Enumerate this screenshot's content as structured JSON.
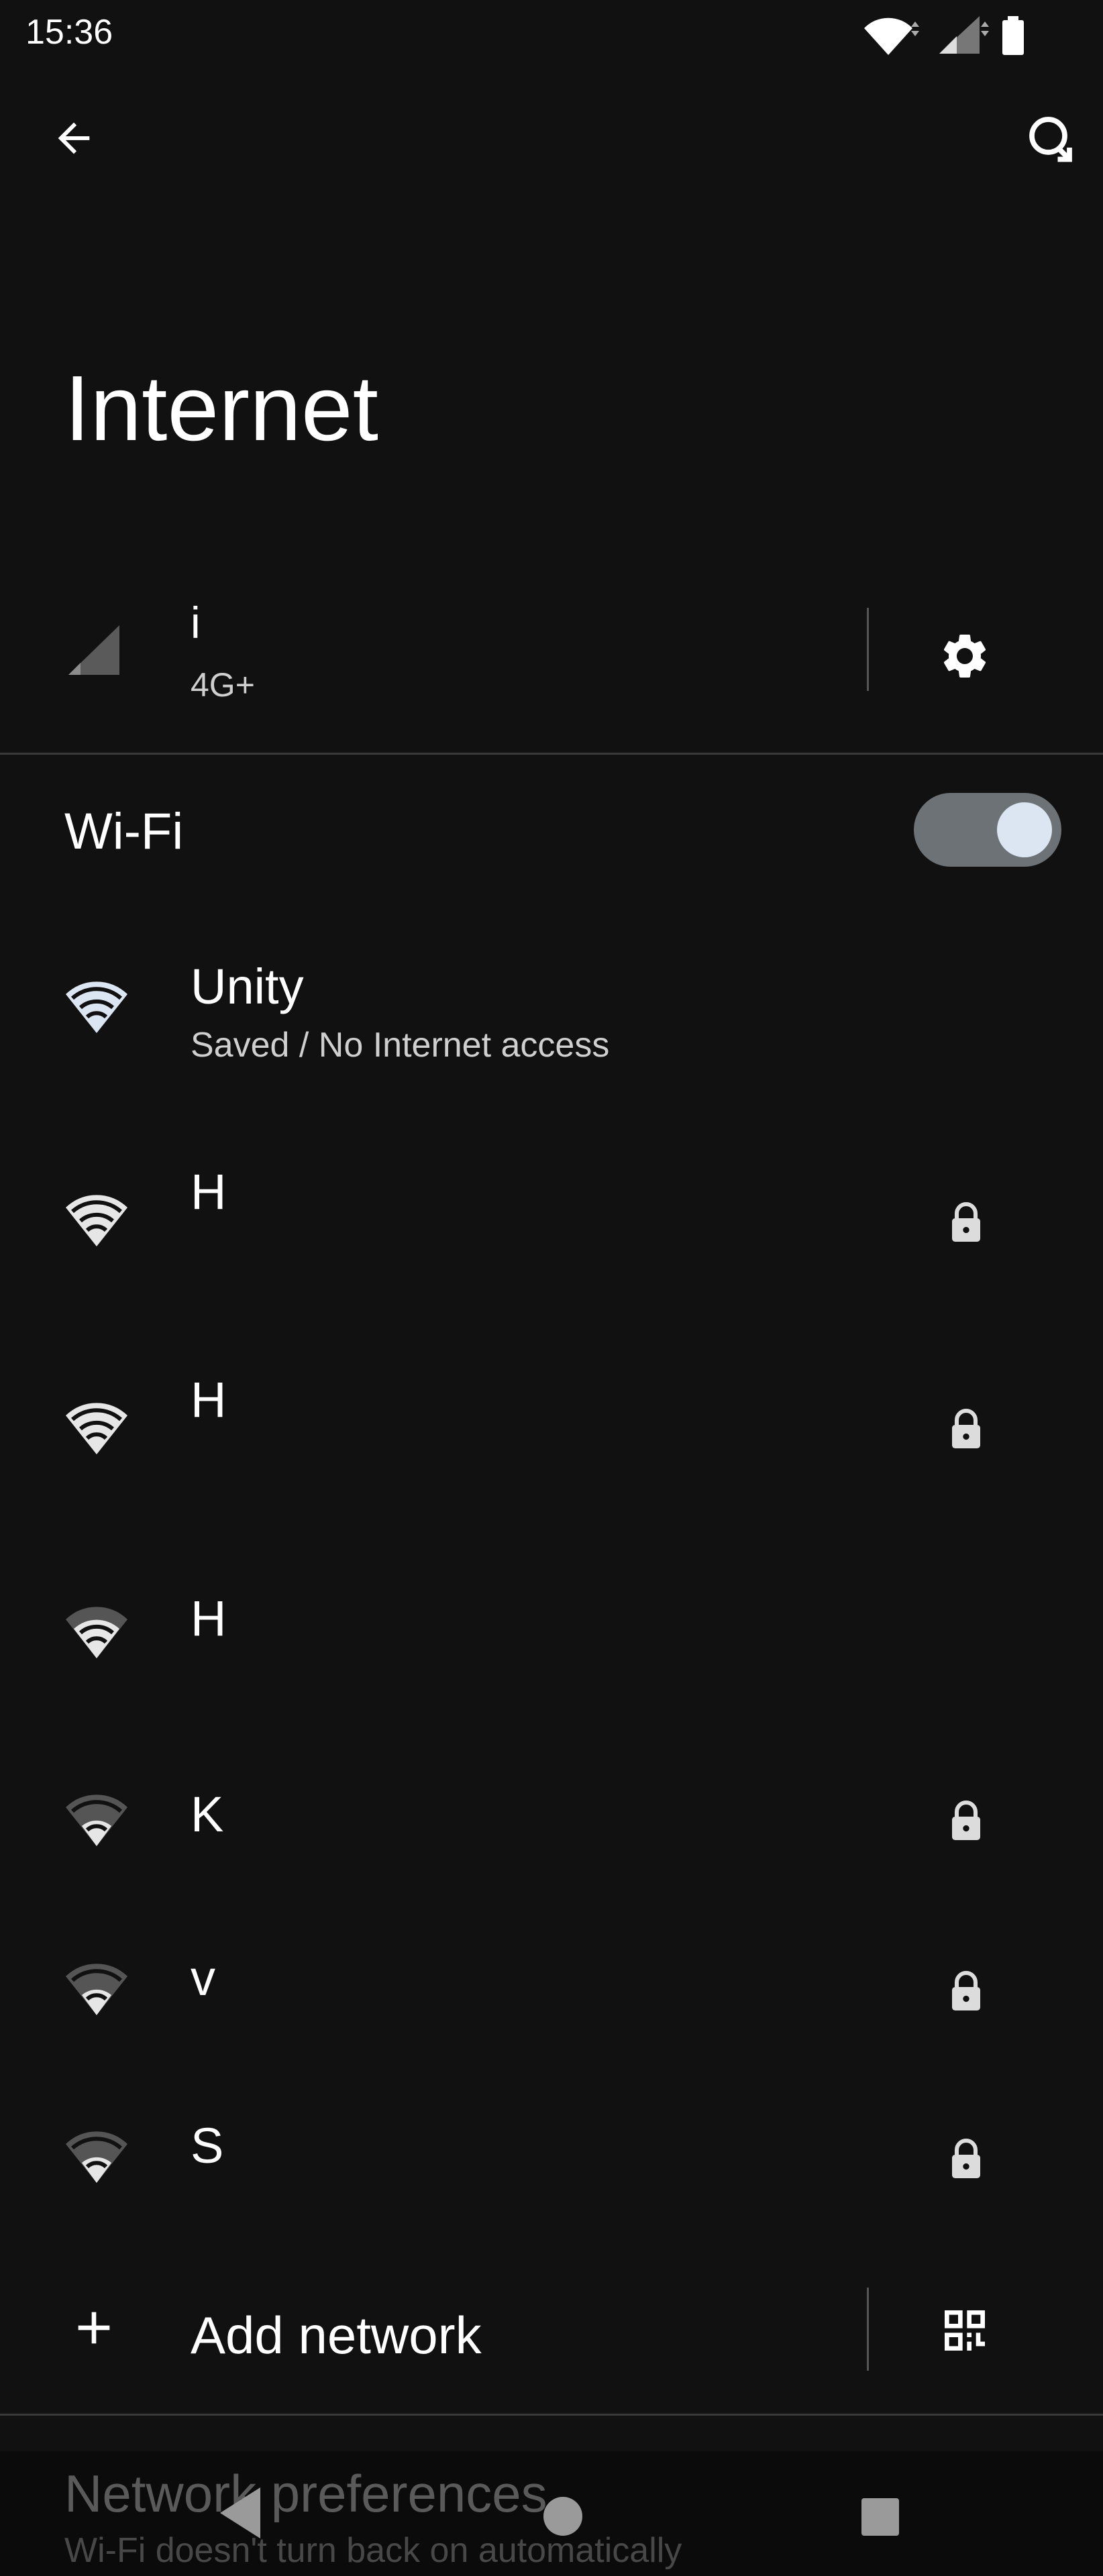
{
  "status_bar": {
    "time": "15:36",
    "icons": [
      "wifi-icon",
      "cell-signal-icon",
      "battery-icon"
    ]
  },
  "app_bar": {
    "back_icon": "arrow-back-icon",
    "refresh_icon": "refresh-icon"
  },
  "title": "Internet",
  "mobile": {
    "name": "i",
    "network_type": "4G+",
    "settings_icon": "gear-icon"
  },
  "wifi": {
    "label": "Wi-Fi",
    "enabled": true
  },
  "networks": [
    {
      "name": "Unity",
      "subtitle": "Saved / No Internet access",
      "signal": 4,
      "locked": false,
      "highlight": true
    },
    {
      "name": "H",
      "subtitle": "",
      "signal": 4,
      "locked": true
    },
    {
      "name": "H",
      "subtitle": "",
      "signal": 4,
      "locked": true
    },
    {
      "name": "H",
      "subtitle": "",
      "signal": 3,
      "locked": false
    },
    {
      "name": "K",
      "subtitle": "",
      "signal": 2,
      "locked": true
    },
    {
      "name": "v",
      "subtitle": "",
      "signal": 2,
      "locked": true
    },
    {
      "name": "S",
      "subtitle": "",
      "signal": 2,
      "locked": true
    }
  ],
  "add_network": {
    "label": "Add network",
    "qr_icon": "qr-code-add-icon"
  },
  "preferences": {
    "title": "Network preferences",
    "subtitle": "Wi-Fi doesn't turn back on automatically"
  },
  "colors": {
    "background": "#111111",
    "accent_wifi": "#dce6f2",
    "divider": "#3a3a3a"
  }
}
